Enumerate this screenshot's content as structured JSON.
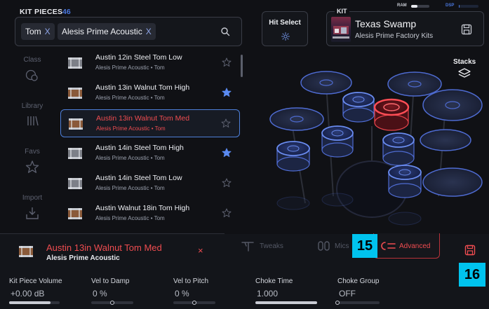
{
  "kit_pieces": {
    "title": "KIT PIECES",
    "count": "46",
    "filters": [
      {
        "label": "Tom",
        "remove": "X"
      },
      {
        "label": "Alesis Prime Acoustic",
        "remove": "X"
      }
    ]
  },
  "sidebar": {
    "items": [
      {
        "label": "Class",
        "icon": "class-icon"
      },
      {
        "label": "Library",
        "icon": "library-icon"
      },
      {
        "label": "Favs",
        "icon": "star-icon"
      },
      {
        "label": "Import",
        "icon": "import-icon"
      }
    ]
  },
  "pieces": [
    {
      "name": "Austin 12in Steel Tom Low",
      "sub": "Alesis Prime Acoustic • Tom",
      "fav": false,
      "selected": false,
      "finish": "steel"
    },
    {
      "name": "Austin 13in Walnut Tom High",
      "sub": "Alesis Prime Acoustic • Tom",
      "fav": true,
      "selected": false,
      "finish": "walnut"
    },
    {
      "name": "Austin 13in Walnut Tom Med",
      "sub": "Alesis Prime Acoustic • Tom",
      "fav": false,
      "selected": true,
      "finish": "walnut"
    },
    {
      "name": "Austin 14in Steel Tom High",
      "sub": "Alesis Prime Acoustic • Tom",
      "fav": true,
      "selected": false,
      "finish": "steel"
    },
    {
      "name": "Austin 14in Steel Tom Low",
      "sub": "Alesis Prime Acoustic • Tom",
      "fav": false,
      "selected": false,
      "finish": "steel"
    },
    {
      "name": "Austin Walnut 18in Tom High",
      "sub": "Alesis Prime Acoustic • Tom",
      "fav": false,
      "selected": false,
      "finish": "walnut"
    }
  ],
  "hit_select": {
    "label": "Hit Select"
  },
  "kit": {
    "label": "KIT",
    "name": "Texas Swamp",
    "sub": "Alesis Prime Factory Kits",
    "ram_label": "RAM",
    "dsp_label": "DSP",
    "ram_level": 0.35,
    "dsp_level": 0.05
  },
  "stacks": {
    "label": "Stacks"
  },
  "selected_piece": {
    "name": "Austin 13in Walnut Tom Med",
    "sub": "Alesis Prime Acoustic",
    "close": "×"
  },
  "tabs": [
    {
      "label": "Tweaks",
      "icon": "tweaks-icon",
      "active": false
    },
    {
      "label": "Mics",
      "icon": "mics-icon",
      "active": false
    },
    {
      "label": "Advanced",
      "icon": "wrench-icon",
      "active": true
    }
  ],
  "badges": {
    "advanced": "15",
    "save": "16"
  },
  "params": [
    {
      "label": "Kit Piece Volume",
      "value": "+0.00 dB",
      "kind": "fill",
      "level": 0.82
    },
    {
      "label": "Vel to Damp",
      "value": "0 %",
      "kind": "center",
      "level": 0.5
    },
    {
      "label": "Vel to Pitch",
      "value": "0 %",
      "kind": "center",
      "level": 0.5
    },
    {
      "label": "Choke Time",
      "value": "1.000",
      "kind": "fill",
      "level": 1.0
    },
    {
      "label": "Choke Group",
      "value": "OFF",
      "kind": "knob",
      "level": 0.0
    }
  ],
  "colors": {
    "accent_blue": "#4a78e0",
    "accent_red": "#ef4c50",
    "badge": "#00c3ee"
  }
}
